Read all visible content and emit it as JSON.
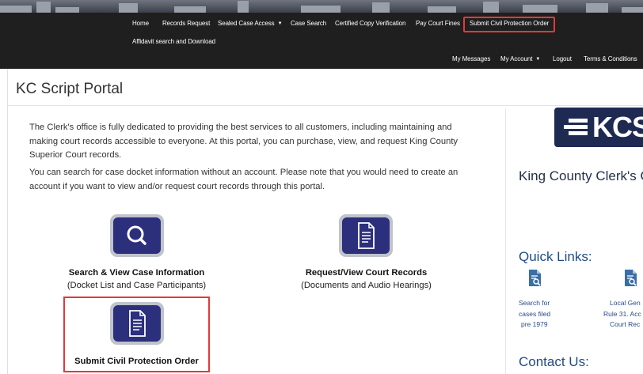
{
  "header": {
    "nav_primary": [
      {
        "label": "Home",
        "dropdown": false
      },
      {
        "label": "Records Request",
        "dropdown": false
      },
      {
        "label": "Sealed Case Access",
        "dropdown": true
      },
      {
        "label": "Case Search",
        "dropdown": false
      },
      {
        "label": "Certified Copy Verification",
        "dropdown": false
      },
      {
        "label": "Pay Court Fines",
        "dropdown": false
      },
      {
        "label": "Submit Civil Protection Order",
        "dropdown": false
      }
    ],
    "nav_secondary": {
      "label": "Affidavit search and Download"
    },
    "user_nav": [
      {
        "label": "My Messages",
        "dropdown": false
      },
      {
        "label": "My Account",
        "dropdown": true
      },
      {
        "label": "Logout",
        "dropdown": false
      },
      {
        "label": "Terms & Conditions",
        "dropdown": false
      }
    ],
    "highlighted_item": "Submit Civil Protection Order"
  },
  "page": {
    "title": "KC Script Portal",
    "intro_paragraph_1": "The Clerk's office is fully dedicated to providing the best services to all customers, including maintaining and making court records accessible to everyone. At this portal, you can purchase, view, and request King County Superior Court records.",
    "intro_paragraph_2": "You can search for case docket information without an account. Please note that you would need to create an account if you want to view and/or request court records through this portal."
  },
  "tiles": {
    "search_case": {
      "title": "Search & View Case Information",
      "subtitle": "(Docket List and Case Participants)",
      "icon": "magnifier-icon"
    },
    "request_records": {
      "title": "Request/View Court Records",
      "subtitle": "(Documents and Audio Hearings)",
      "icon": "document-icon"
    },
    "submit_protection": {
      "title": "Submit Civil Protection Order",
      "icon": "document-icon"
    }
  },
  "sidebar": {
    "logo_text": "KCSC",
    "clerk_heading": "King County Clerk's O",
    "quick_links_heading": "Quick Links:",
    "quick_links": [
      {
        "lines": [
          "Search for",
          "cases filed",
          "pre 1979"
        ],
        "icon": "search-document-icon"
      },
      {
        "lines": [
          "Local Gen",
          "Rule 31. Acc",
          "Court Rec"
        ],
        "icon": "search-document-icon"
      }
    ],
    "contact_heading": "Contact Us:"
  },
  "colors": {
    "header_bg": "#1f1f1f",
    "highlight_red": "#e2393b",
    "tile_blue": "#2b2f7c",
    "tile_frame": "#bfc3cb",
    "link_blue": "#1f4b8a",
    "logo_navy": "#1e2a52"
  }
}
